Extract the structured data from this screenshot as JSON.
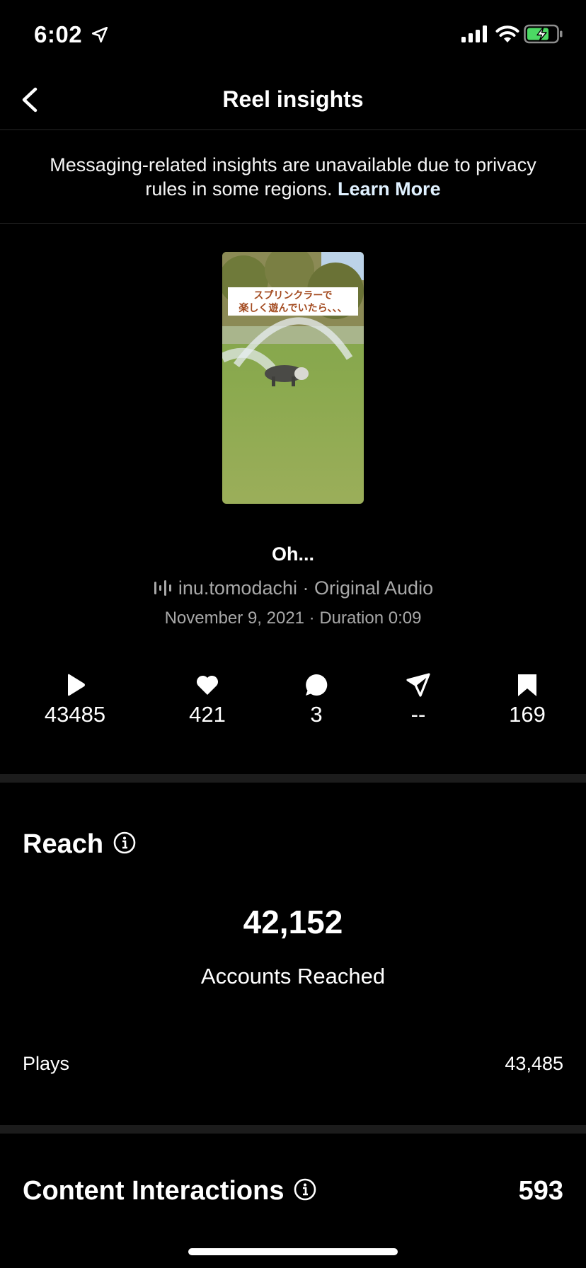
{
  "status_bar": {
    "time": "6:02"
  },
  "header": {
    "title": "Reel insights"
  },
  "notice": {
    "text": "Messaging-related insights are unavailable due to privacy rules in some regions.",
    "link": "Learn More"
  },
  "reel": {
    "overlay_line1": "スプリンクラーで",
    "overlay_line2": "楽しく遊んでいたら、、、",
    "caption": "Oh...",
    "audio": "inu.tomodachi · Original Audio",
    "meta": "November 9, 2021 · Duration 0:09"
  },
  "stats": {
    "plays": "43485",
    "likes": "421",
    "comments": "3",
    "shares": "--",
    "saves": "169"
  },
  "reach": {
    "title": "Reach",
    "accounts_reached": "42,152",
    "accounts_reached_label": "Accounts Reached",
    "plays_label": "Plays",
    "plays_value": "43,485"
  },
  "content_interactions": {
    "title": "Content Interactions",
    "value": "593"
  },
  "colors": {
    "background": "#000000",
    "divider": "#1c1c1c",
    "secondary_text": "#a8a8a8",
    "battery_green": "#4cd964"
  }
}
